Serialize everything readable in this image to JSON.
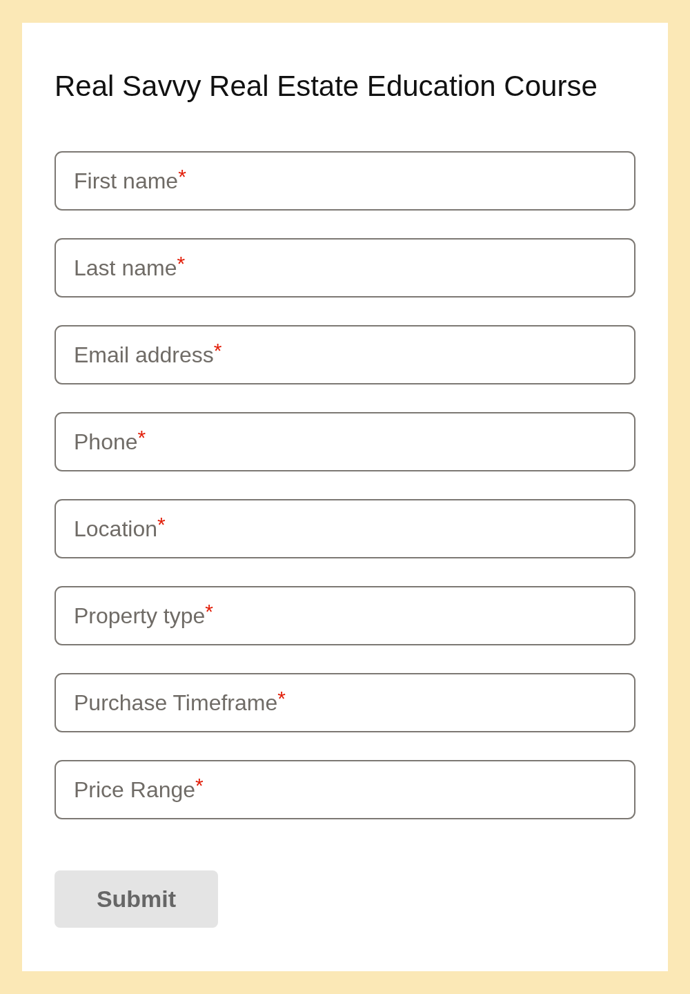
{
  "form": {
    "title": "Real Savvy Real Estate Education Course",
    "fields": [
      {
        "placeholder": "First name",
        "required_mark": "*"
      },
      {
        "placeholder": "Last name",
        "required_mark": "*"
      },
      {
        "placeholder": "Email address",
        "required_mark": "*"
      },
      {
        "placeholder": "Phone",
        "required_mark": "*"
      },
      {
        "placeholder": "Location",
        "required_mark": "*"
      },
      {
        "placeholder": "Property type",
        "required_mark": "*"
      },
      {
        "placeholder": "Purchase Timeframe",
        "required_mark": "*"
      },
      {
        "placeholder": "Price Range",
        "required_mark": "*"
      }
    ],
    "submit_button": {
      "label": "Submit"
    }
  }
}
